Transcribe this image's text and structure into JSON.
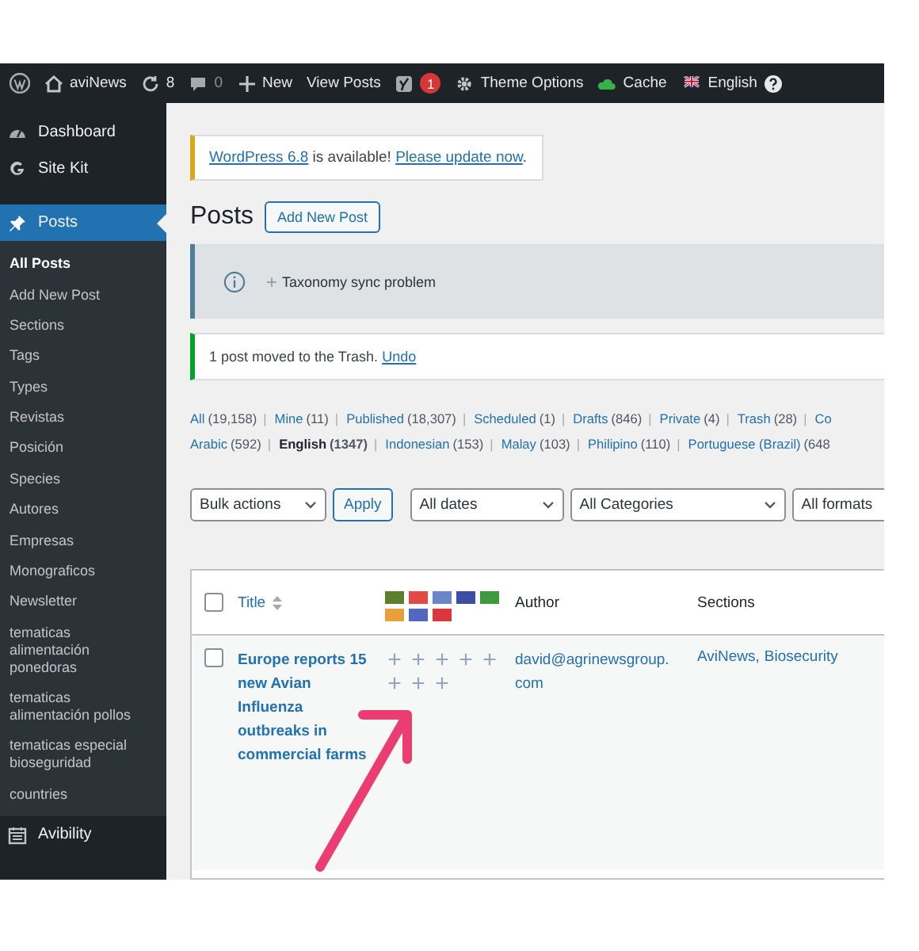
{
  "admin_bar": {
    "items": [
      {
        "kind": "logo"
      },
      {
        "kind": "site",
        "label": "aviNews"
      },
      {
        "kind": "updates",
        "label": "8"
      },
      {
        "kind": "comments",
        "label": "0"
      },
      {
        "kind": "new",
        "label": "New"
      },
      {
        "kind": "link",
        "label": "View Posts"
      },
      {
        "kind": "seo",
        "label": "1"
      },
      {
        "kind": "options",
        "label": "Theme Options"
      },
      {
        "kind": "cache",
        "label": "Cache"
      },
      {
        "kind": "language",
        "label": "English"
      }
    ]
  },
  "sidebar": {
    "items": [
      {
        "kind": "dashboard",
        "label": "Dashboard",
        "selected": false
      },
      {
        "kind": "sitekit",
        "label": "Site Kit",
        "selected": false
      },
      {
        "kind": "posts",
        "label": "Posts",
        "selected": true,
        "children": [
          {
            "label": "All Posts",
            "selected": true
          },
          {
            "label": "Add New Post",
            "selected": false
          },
          {
            "label": "Sections",
            "selected": false
          },
          {
            "label": "Tags",
            "selected": false
          },
          {
            "label": "Types",
            "selected": false
          },
          {
            "label": "Revistas",
            "selected": false
          },
          {
            "label": "Posición",
            "selected": false
          },
          {
            "label": "Species",
            "selected": false
          },
          {
            "label": "Autores",
            "selected": false
          },
          {
            "label": "Empresas",
            "selected": false
          },
          {
            "label": "Monograficos",
            "selected": false
          },
          {
            "label": "Newsletter",
            "selected": false
          },
          {
            "label": "tematicas alimentación ponedoras",
            "selected": false
          },
          {
            "label": "tematicas alimentación pollos",
            "selected": false
          },
          {
            "label": "tematicas especial bioseguridad",
            "selected": false
          },
          {
            "label": "countries",
            "selected": false
          }
        ]
      },
      {
        "kind": "calendar",
        "label": "Avibility",
        "selected": false
      }
    ]
  },
  "update_notice": {
    "parts": [
      {
        "text": "WordPress 6.8",
        "link": true
      },
      {
        "text": " is available! ",
        "link": false
      },
      {
        "text": "Please update now",
        "link": true
      },
      {
        "text": ".",
        "link": false
      }
    ]
  },
  "page_title": "Posts",
  "add_new_button": "Add New Post",
  "info_notice": {
    "toggle": "+",
    "text": "Taxonomy sync problem"
  },
  "trash_notice": {
    "text": "1 post moved to the Trash.",
    "link": "Undo"
  },
  "post_statuses": [
    {
      "label": "All",
      "count": "(19,158)",
      "selected": false
    },
    {
      "separator": "|",
      "label": "Mine",
      "count": "(11)",
      "selected": false
    },
    {
      "separator": "|",
      "label": "Published",
      "count": "(18,307)",
      "selected": false
    },
    {
      "separator": "|",
      "label": "Scheduled",
      "count": "(1)",
      "selected": false
    },
    {
      "separator": "|",
      "label": "Drafts",
      "count": "(846)",
      "selected": false
    },
    {
      "separator": "|",
      "label": "Private",
      "count": "(4)",
      "selected": false
    },
    {
      "separator": "|",
      "label": "Trash",
      "count": "(28)",
      "selected": false
    },
    {
      "separator": "|",
      "label": "Co",
      "selected": false
    }
  ],
  "languages": [
    {
      "label": "Arabic",
      "count": "(592)",
      "selected": false
    },
    {
      "separator": "|",
      "label": "English",
      "count": "(1347)",
      "selected": true
    },
    {
      "separator": "|",
      "label": "Indonesian",
      "count": "(153)",
      "selected": false
    },
    {
      "separator": "|",
      "label": "Malay",
      "count": "(103)",
      "selected": false
    },
    {
      "separator": "|",
      "label": "Philipino",
      "count": "(110)",
      "selected": false
    },
    {
      "separator": "|",
      "label": "Portuguese (Brazil)",
      "count": "(648",
      "selected": false
    }
  ],
  "filters": {
    "bulk_actions": "Bulk actions",
    "apply": "Apply",
    "dates": "All dates",
    "categories": "All Categories",
    "formats": "All formats"
  },
  "table": {
    "select_all_checked": false,
    "columns": {
      "title": "Title",
      "author": "Author",
      "sections": "Sections"
    },
    "flags": [
      {
        "color": "#5b7f2a"
      },
      {
        "color": "#e24a4a"
      },
      {
        "color": "#6a86c9"
      },
      {
        "color": "#3d4fa3"
      },
      {
        "color": "#3f9a3f"
      },
      {
        "color": "#e8a13a"
      },
      {
        "color": "#5566c0"
      },
      {
        "color": "#d9363e"
      }
    ],
    "rows": [
      {
        "checked": false,
        "title": "Europe reports 15 new Avian Influenza outbreaks in commercial farms",
        "translations": [
          "+",
          "+",
          "+",
          "+",
          "+",
          "+",
          "+",
          "+"
        ],
        "author": "david@agrinewsgroup.com",
        "sections": [
          "AviNews,",
          "Biosecurity"
        ]
      }
    ]
  }
}
